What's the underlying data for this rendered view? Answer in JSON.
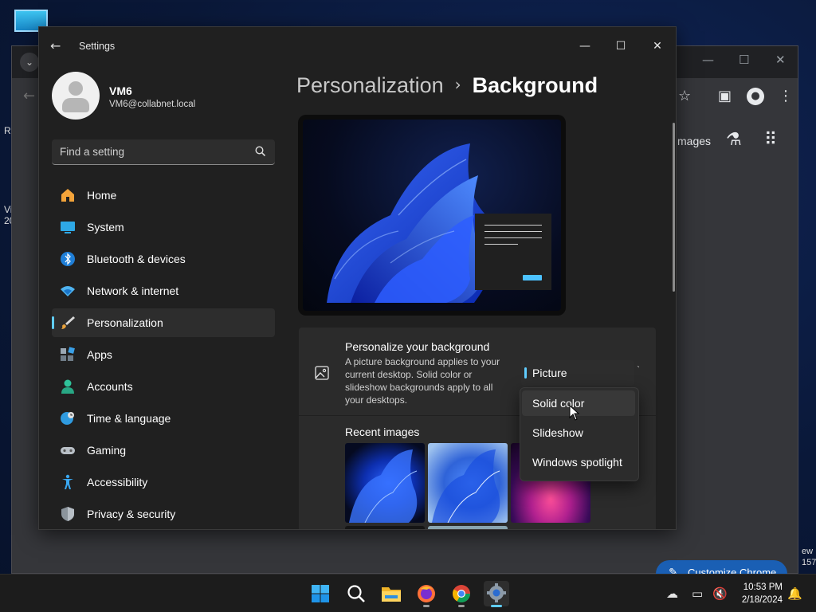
{
  "desktop": {
    "left_texts": [
      "R",
      "Vi",
      "20"
    ],
    "right_texts": [
      "ew",
      "157"
    ]
  },
  "chrome": {
    "images_link": "mages",
    "customize_label": "Customize Chrome"
  },
  "settings": {
    "window_title": "Settings",
    "user": {
      "name": "VM6",
      "email": "VM6@collabnet.local"
    },
    "search_placeholder": "Find a setting",
    "nav": [
      {
        "label": "Home",
        "icon": "home-icon"
      },
      {
        "label": "System",
        "icon": "system-icon"
      },
      {
        "label": "Bluetooth & devices",
        "icon": "bluetooth-icon"
      },
      {
        "label": "Network & internet",
        "icon": "network-icon"
      },
      {
        "label": "Personalization",
        "icon": "personalization-icon",
        "active": true
      },
      {
        "label": "Apps",
        "icon": "apps-icon"
      },
      {
        "label": "Accounts",
        "icon": "accounts-icon"
      },
      {
        "label": "Time & language",
        "icon": "time-language-icon"
      },
      {
        "label": "Gaming",
        "icon": "gaming-icon"
      },
      {
        "label": "Accessibility",
        "icon": "accessibility-icon"
      },
      {
        "label": "Privacy & security",
        "icon": "privacy-icon"
      }
    ],
    "breadcrumb": {
      "parent": "Personalization",
      "separator": "›",
      "current": "Background"
    },
    "background_card": {
      "title": "Personalize your background",
      "description": "A picture background applies to your current desktop. Solid color or slideshow backgrounds apply to all your desktops."
    },
    "dropdown": {
      "selected": "Picture",
      "options": [
        "Solid color",
        "Slideshow",
        "Windows spotlight"
      ],
      "hovered": "Solid color"
    },
    "recent_images_label": "Recent images"
  },
  "taskbar": {
    "apps": [
      "start-icon",
      "search-icon",
      "file-explorer-icon",
      "firefox-icon",
      "chrome-icon",
      "settings-icon"
    ],
    "time": "10:53 PM",
    "date": "2/18/2024"
  },
  "colors": {
    "accent": "#60cdff",
    "window_bg": "#202020",
    "card_bg": "#2b2b2b"
  }
}
